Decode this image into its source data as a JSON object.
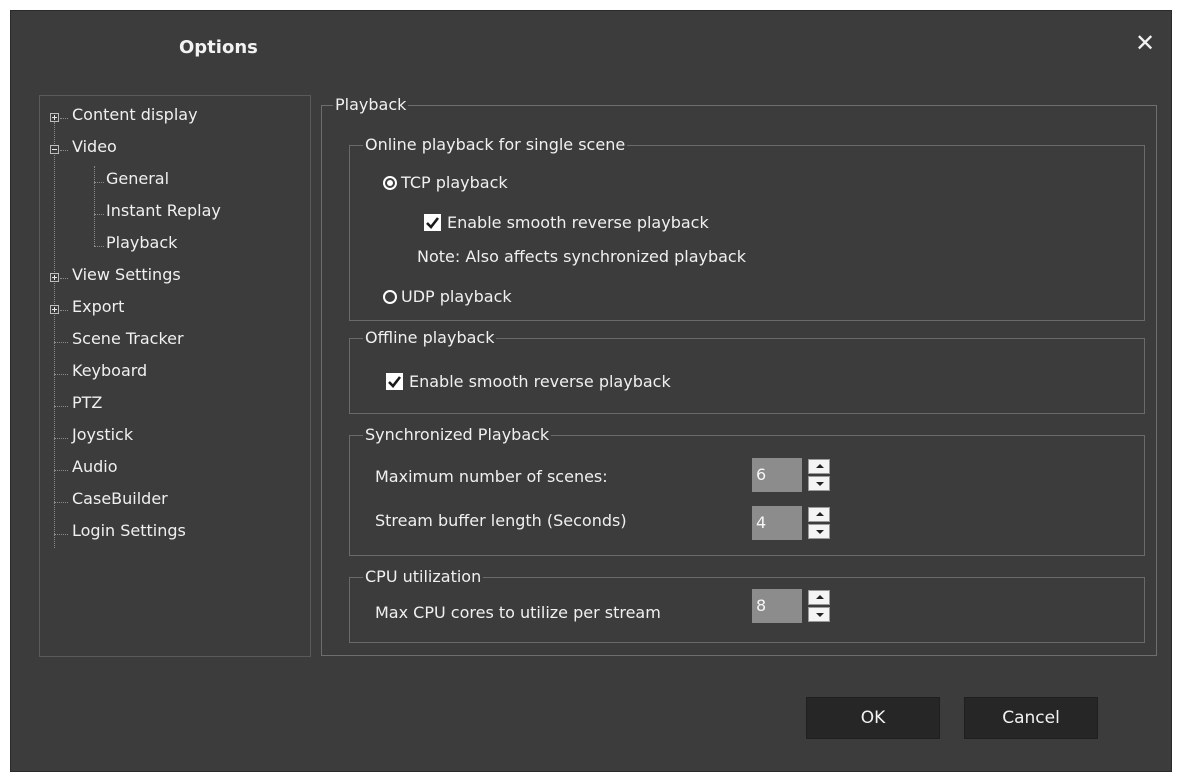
{
  "window": {
    "title": "Options",
    "close_glyph": "✕"
  },
  "tree": {
    "items": [
      {
        "label": "Content display",
        "expander": "plus"
      },
      {
        "label": "Video",
        "expander": "minus"
      },
      {
        "label": "General"
      },
      {
        "label": "Instant Replay"
      },
      {
        "label": "Playback"
      },
      {
        "label": "View Settings",
        "expander": "plus"
      },
      {
        "label": "Export",
        "expander": "plus"
      },
      {
        "label": "Scene Tracker"
      },
      {
        "label": "Keyboard"
      },
      {
        "label": "PTZ"
      },
      {
        "label": "Joystick"
      },
      {
        "label": "Audio"
      },
      {
        "label": "CaseBuilder"
      },
      {
        "label": "Login Settings"
      }
    ]
  },
  "panel": {
    "title": "Playback",
    "online": {
      "title": "Online playback for single scene",
      "tcp_label": "TCP playback",
      "tcp_selected": true,
      "smooth_label": "Enable smooth reverse playback",
      "smooth_checked": true,
      "note": "Note: Also affects synchronized playback",
      "udp_label": "UDP playback",
      "udp_selected": false
    },
    "offline": {
      "title": "Offline playback",
      "smooth_label": "Enable smooth reverse playback",
      "smooth_checked": true
    },
    "sync": {
      "title": "Synchronized Playback",
      "max_scenes_label": "Maximum number of scenes:",
      "max_scenes_value": "6",
      "buffer_label": "Stream buffer length (Seconds)",
      "buffer_value": "4"
    },
    "cpu": {
      "title": "CPU utilization",
      "cores_label": "Max CPU cores to utilize per stream",
      "cores_value": "8"
    }
  },
  "buttons": {
    "ok": "OK",
    "cancel": "Cancel"
  },
  "colors": {
    "dialog_bg": "#3c3c3c",
    "button_bg": "#262626",
    "spin_value_bg": "#8c8c8c"
  }
}
